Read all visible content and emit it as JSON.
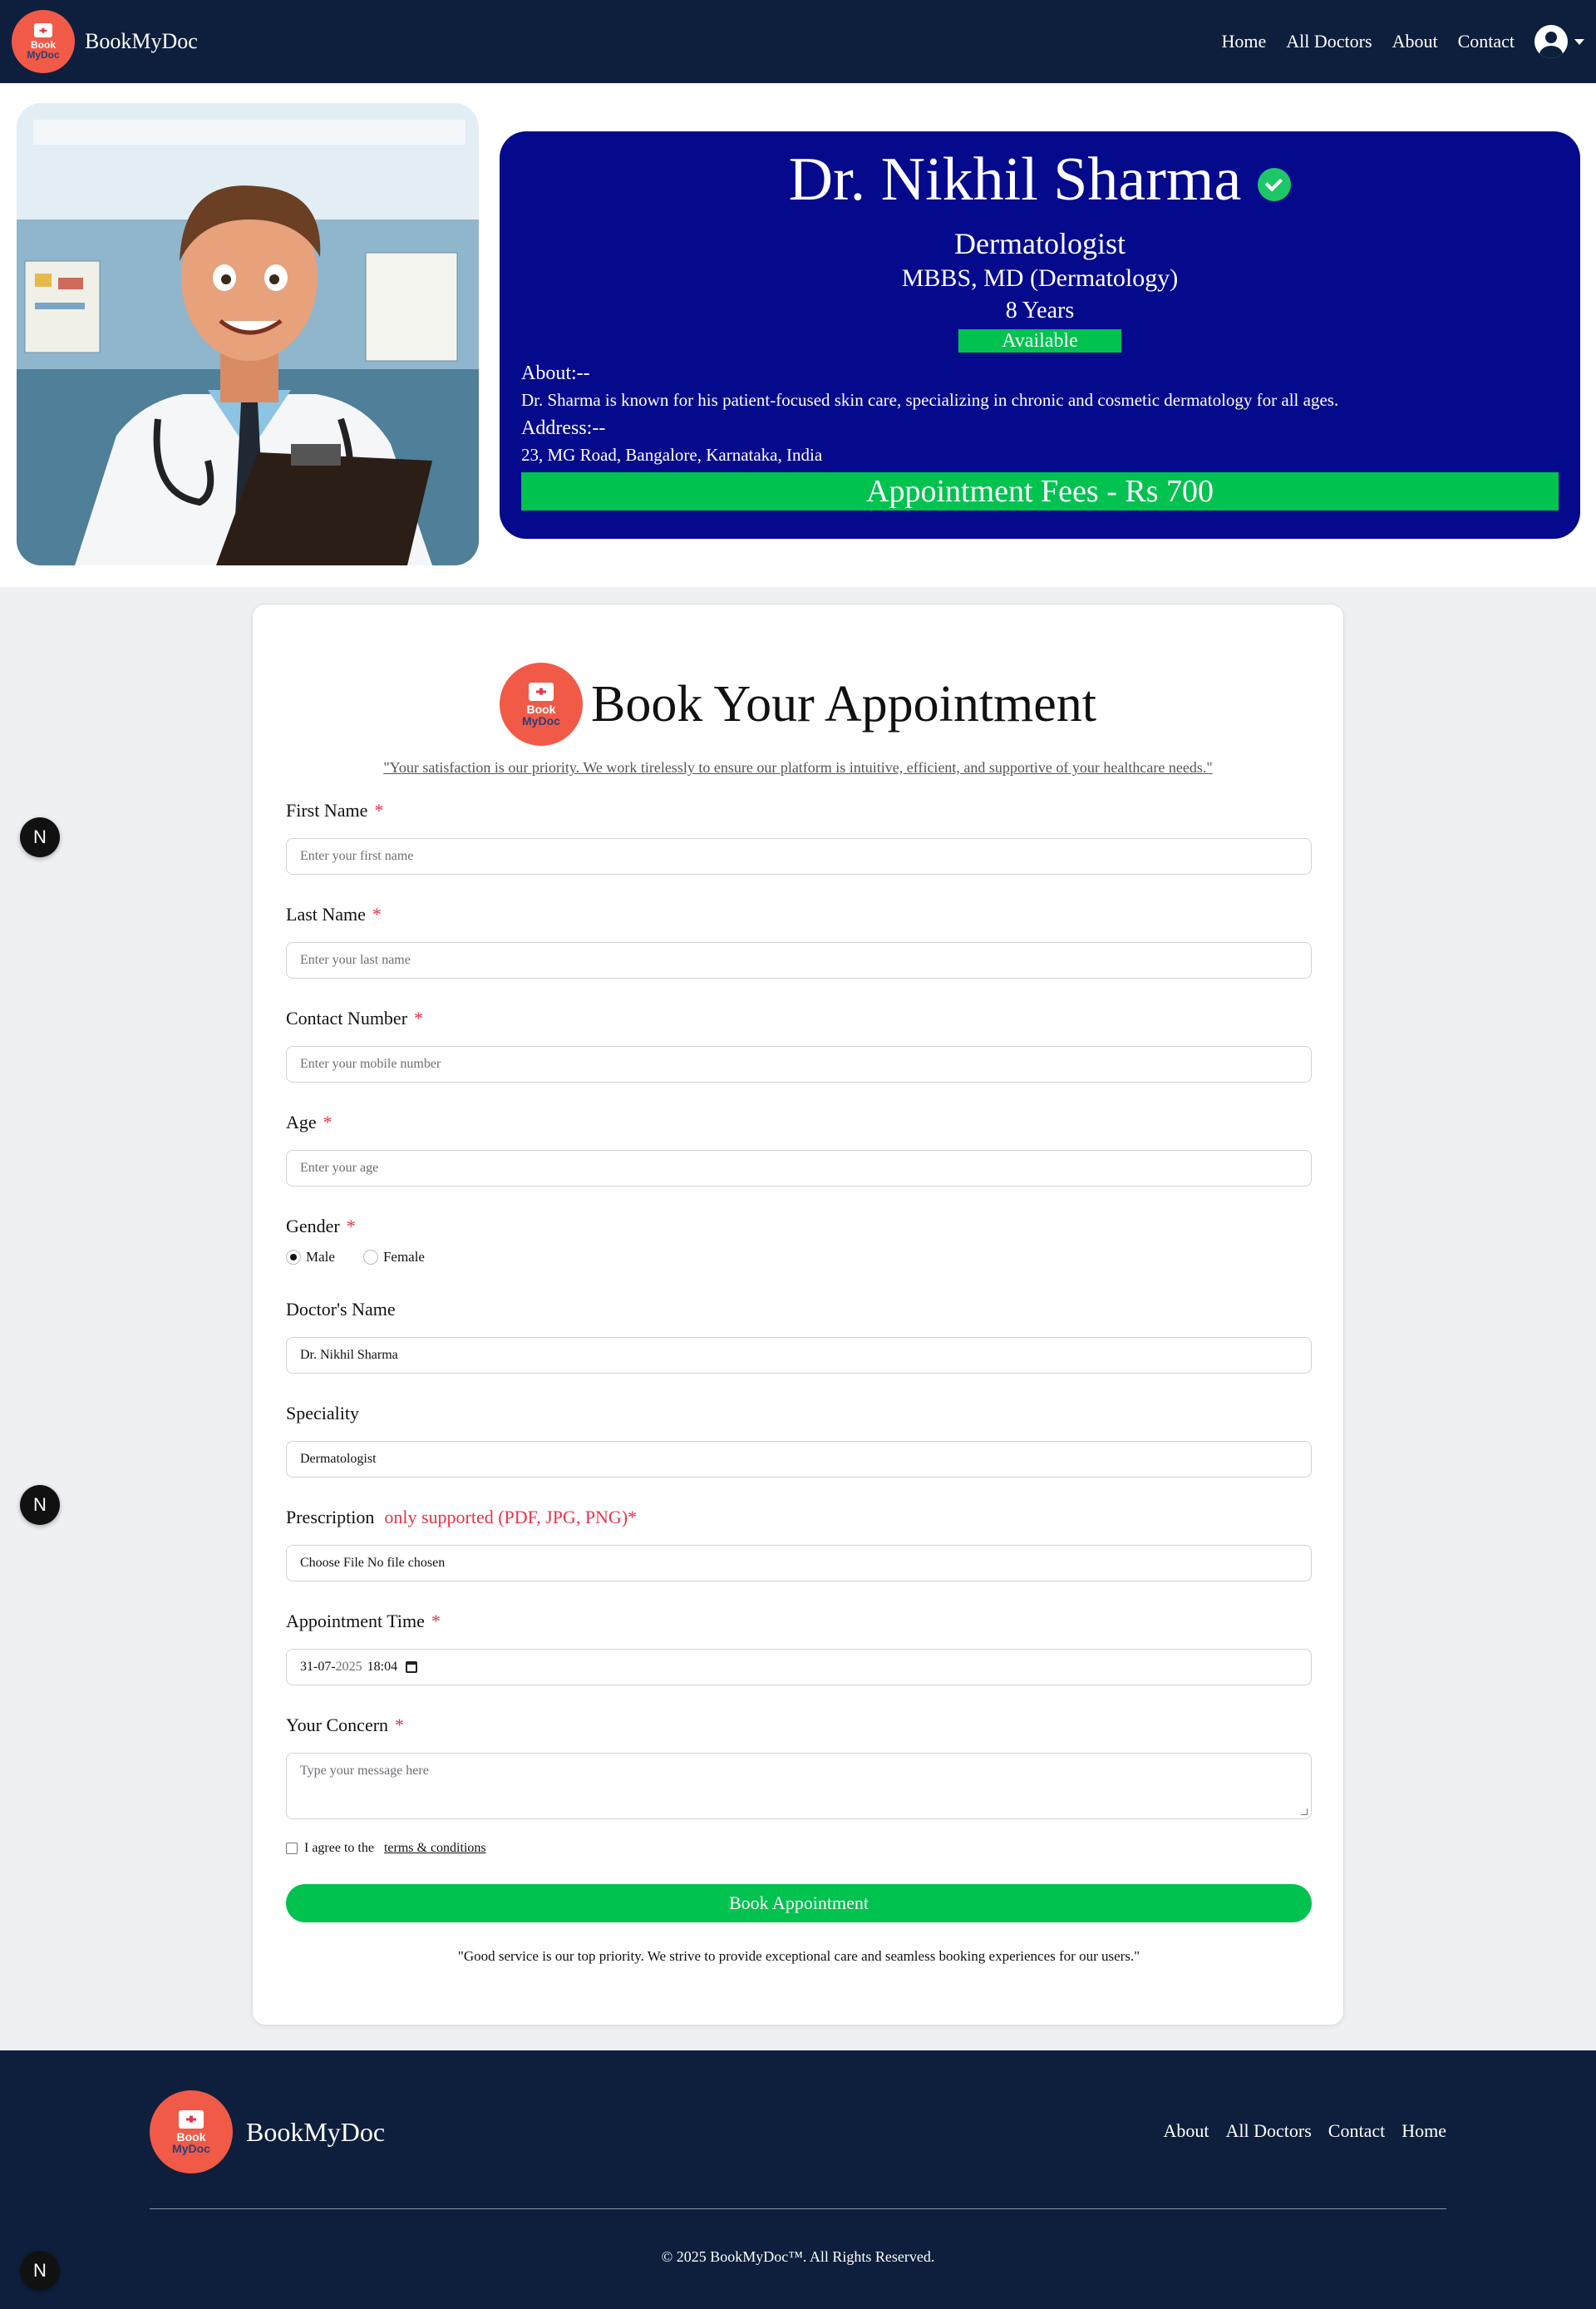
{
  "nav": {
    "brand": "BookMyDoc",
    "logo_line1": "Book",
    "logo_line2": "MyDoc",
    "links": [
      "Home",
      "All Doctors",
      "About",
      "Contact"
    ]
  },
  "doctor": {
    "name": "Dr. Nikhil Sharma",
    "specialty": "Dermatologist",
    "degree": "MBBS, MD (Dermatology)",
    "experience": "8 Years",
    "status": "Available",
    "about_label": "About:--",
    "about": "Dr. Sharma is known for his patient-focused skin care, specializing in chronic and cosmetic dermatology for all ages.",
    "address_label": "Address:--",
    "address": "23, MG Road, Bangalore, Karnataka, India",
    "fees": "Appointment Fees - Rs 700"
  },
  "form": {
    "title": "Book Your Appointment",
    "quote": "\"Your satisfaction is our priority. We work tirelessly to ensure our platform is intuitive, efficient, and supportive of your healthcare needs.\"",
    "required_mark": "*",
    "first_name": {
      "label": "First Name",
      "placeholder": "Enter your first name"
    },
    "last_name": {
      "label": "Last Name",
      "placeholder": "Enter your last name"
    },
    "contact": {
      "label": "Contact Number",
      "placeholder": "Enter your mobile number"
    },
    "age": {
      "label": "Age",
      "placeholder": "Enter your age"
    },
    "gender": {
      "label": "Gender",
      "options": [
        "Male",
        "Female"
      ],
      "selected": "Male"
    },
    "doctor_name": {
      "label": "Doctor's Name",
      "value": "Dr. Nikhil Sharma"
    },
    "speciality": {
      "label": "Speciality",
      "value": "Dermatologist"
    },
    "prescription": {
      "label": "Prescription",
      "note": "only supported (PDF, JPG, PNG)*",
      "value": "Choose File No file chosen"
    },
    "appointment_time": {
      "label": "Appointment Time",
      "date": "31-07-",
      "year": "2025",
      "time": "18:04"
    },
    "concern": {
      "label": "Your Concern",
      "placeholder": "Type your message here"
    },
    "terms_prefix": "I agree to the",
    "terms_link": "terms & conditions",
    "submit": "Book Appointment",
    "bottom_quote": "\"Good service is our top priority. We strive to provide exceptional care and seamless booking experiences for our users.\""
  },
  "footer": {
    "brand": "BookMyDoc",
    "links": [
      "About",
      "All Doctors",
      "Contact",
      "Home"
    ],
    "copyright": "© 2025 BookMyDoc™. All Rights Reserved."
  },
  "floating_badge": "N",
  "colors": {
    "navy": "#0e1f3d",
    "card_blue": "#050a8c",
    "green": "#00c24f",
    "logo_red": "#f25a48",
    "required_red": "#e8334a"
  }
}
